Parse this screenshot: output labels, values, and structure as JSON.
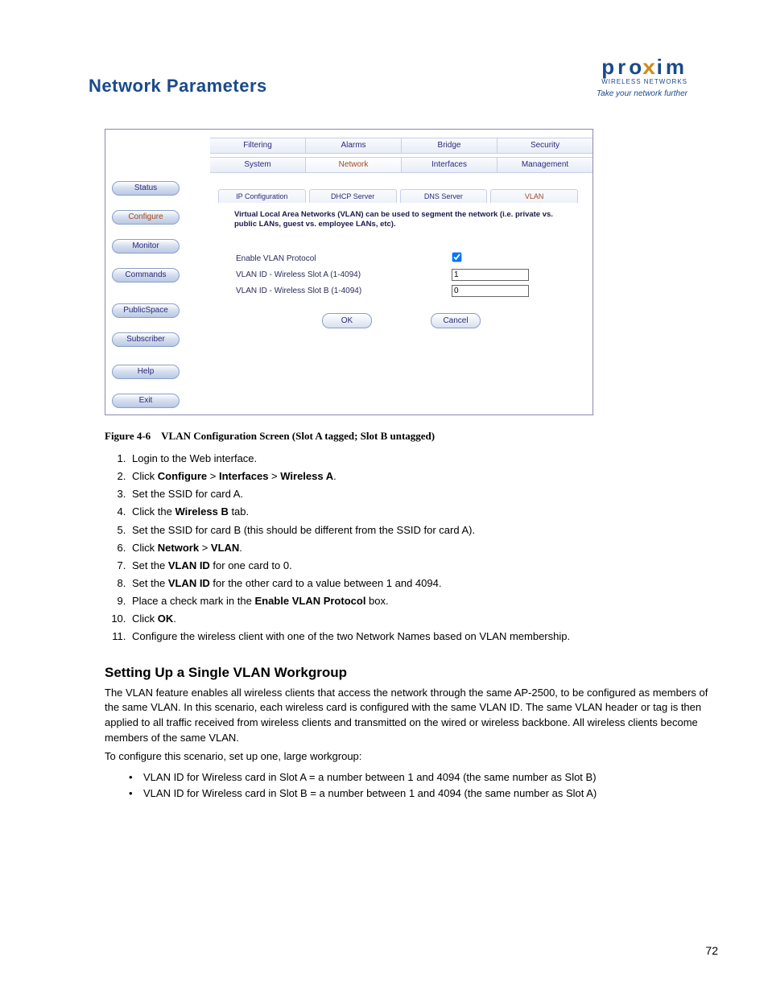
{
  "header": {
    "title": "Network Parameters",
    "logo_main_left": "pro",
    "logo_main_x": "x",
    "logo_main_right": "im",
    "logo_sub": "WIRELESS NETWORKS",
    "logo_tag": "Take your network further"
  },
  "screenshot": {
    "sidenav": [
      "Status",
      "Configure",
      "Monitor",
      "Commands",
      "PublicSpace",
      "Subscriber",
      "Help",
      "Exit"
    ],
    "sidenav_active_index": 1,
    "tabs_row1": [
      "Filtering",
      "Alarms",
      "Bridge",
      "Security"
    ],
    "tabs_row2": [
      "System",
      "Network",
      "Interfaces",
      "Management"
    ],
    "tabs_row2_active_index": 1,
    "subtabs": [
      "IP Configuration",
      "DHCP Server",
      "DNS Server",
      "VLAN"
    ],
    "subtabs_active_index": 3,
    "description": "Virtual Local Area Networks (VLAN) can be used to segment the network (i.e. private vs. public LANs, guest vs. employee LANs, etc).",
    "fields": {
      "enable_label": "Enable VLAN Protocol",
      "enable_checked": true,
      "slot_a_label": "VLAN ID - Wireless Slot A (1-4094)",
      "slot_a_value": "1",
      "slot_b_label": "VLAN ID - Wireless Slot B (1-4094)",
      "slot_b_value": "0"
    },
    "buttons": {
      "ok": "OK",
      "cancel": "Cancel"
    }
  },
  "figure": {
    "label": "Figure 4-6",
    "caption": "VLAN Configuration Screen (Slot A tagged; Slot B untagged)"
  },
  "steps": [
    "Login to the Web interface.",
    "Click <b>Configure</b> > <b>Interfaces</b> > <b>Wireless A</b>.",
    "Set the SSID for card A.",
    "Click the <b>Wireless B</b> tab.",
    "Set the SSID for card B (this should be different from the SSID for card A).",
    "Click <b>Network</b> > <b>VLAN</b>.",
    "Set the <b>VLAN ID</b> for one card to 0.",
    "Set the <b>VLAN ID</b> for the other card to a value between 1 and 4094.",
    "Place a check mark in the <b>Enable VLAN Protocol</b> box.",
    "Click <b>OK</b>.",
    "Configure the wireless client with one of the two Network Names based on VLAN membership."
  ],
  "section": {
    "heading": "Setting Up a Single VLAN Workgroup",
    "para1": "The VLAN feature enables all wireless clients that access the network through the same AP-2500, to be configured as members of the same VLAN. In this scenario, each wireless card is configured with the same VLAN ID. The same VLAN header or tag is then applied to all traffic received from wireless clients and transmitted on the wired or wireless backbone. All wireless clients become members of the same VLAN.",
    "para2": "To configure this scenario, set up one, large workgroup:",
    "bullets": [
      "VLAN ID for Wireless card in Slot A = a number between 1 and 4094 (the same number as Slot B)",
      "VLAN ID for Wireless card in Slot B = a number between 1 and 4094 (the same number as Slot A)"
    ]
  },
  "page_number": "72"
}
